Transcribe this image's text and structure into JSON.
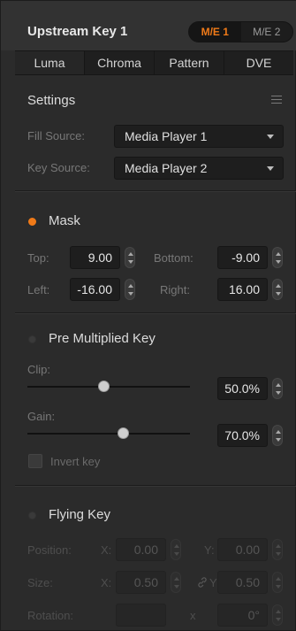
{
  "header": {
    "title": "Upstream Key 1",
    "me_buttons": [
      {
        "label": "M/E 1",
        "active": true
      },
      {
        "label": "M/E 2",
        "active": false
      }
    ]
  },
  "tabs": [
    {
      "label": "Luma",
      "active": true
    },
    {
      "label": "Chroma",
      "active": false
    },
    {
      "label": "Pattern",
      "active": false
    },
    {
      "label": "DVE",
      "active": false
    }
  ],
  "settings": {
    "title": "Settings",
    "menu_icon": "hamburger-menu-icon",
    "fill_source": {
      "label": "Fill Source:",
      "value": "Media Player 1"
    },
    "key_source": {
      "label": "Key Source:",
      "value": "Media Player 2"
    }
  },
  "mask": {
    "title": "Mask",
    "enabled": true,
    "top": {
      "label": "Top:",
      "value": "9.00"
    },
    "bottom": {
      "label": "Bottom:",
      "value": "-9.00"
    },
    "left": {
      "label": "Left:",
      "value": "-16.00"
    },
    "right": {
      "label": "Right:",
      "value": "16.00"
    }
  },
  "pre_multiplied": {
    "title": "Pre Multiplied Key",
    "enabled": false,
    "clip": {
      "label": "Clip:",
      "value": "50.0%",
      "level": 0.5
    },
    "gain": {
      "label": "Gain:",
      "value": "70.0%",
      "level": 0.7
    },
    "invert": {
      "label": "Invert key",
      "checked": false
    }
  },
  "flying_key": {
    "title": "Flying Key",
    "enabled": false,
    "position": {
      "label": "Position:",
      "x_label": "X:",
      "x": "0.00",
      "y_label": "Y:",
      "y": "0.00"
    },
    "size": {
      "label": "Size:",
      "x_label": "X:",
      "x": "0.50",
      "y_label": "Y:",
      "y": "0.50"
    },
    "rotation": {
      "label": "Rotation:",
      "x_label": "x",
      "value": "0°"
    }
  },
  "colors": {
    "accent": "#f07a18",
    "background": "#2b2b2b",
    "field": "#1e1e1e"
  }
}
